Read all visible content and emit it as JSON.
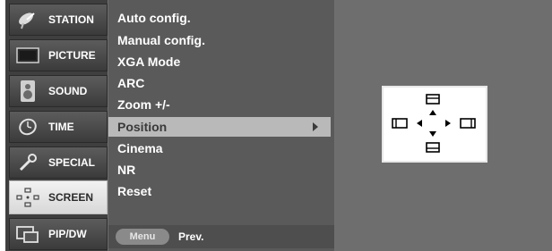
{
  "sidebar": {
    "items": [
      {
        "label": "STATION",
        "icon": "satellite-dish-icon",
        "active": false
      },
      {
        "label": "PICTURE",
        "icon": "tv-screen-icon",
        "active": false
      },
      {
        "label": "SOUND",
        "icon": "speaker-icon",
        "active": false
      },
      {
        "label": "TIME",
        "icon": "clock-icon",
        "active": false
      },
      {
        "label": "SPECIAL",
        "icon": "wrench-icon",
        "active": false
      },
      {
        "label": "SCREEN",
        "icon": "screen-adjust-icon",
        "active": true
      },
      {
        "label": "PIP/DW",
        "icon": "pip-windows-icon",
        "active": false
      }
    ]
  },
  "submenu": {
    "items": [
      {
        "label": "Auto config."
      },
      {
        "label": "Manual config."
      },
      {
        "label": "XGA Mode"
      },
      {
        "label": "ARC"
      },
      {
        "label": "Zoom +/-"
      },
      {
        "label": "Position",
        "selected": true,
        "has_submenu": true
      },
      {
        "label": "Cinema"
      },
      {
        "label": "NR"
      },
      {
        "label": "Reset"
      }
    ]
  },
  "footer": {
    "menu_button": "Menu",
    "prev_label": "Prev."
  },
  "colors": {
    "panel": "#5a5a5a",
    "selected_row": "#b9b9b9",
    "active_tab": "#e6e6e6"
  }
}
